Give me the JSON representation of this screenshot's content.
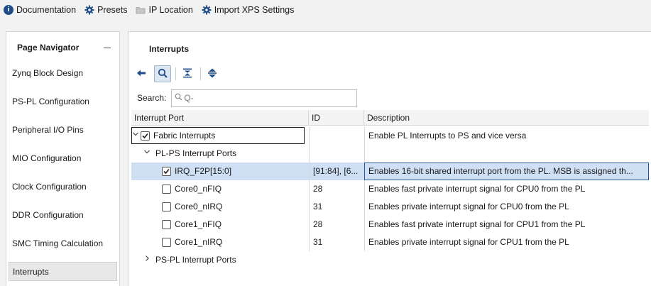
{
  "toolbar": {
    "items": [
      {
        "label": "Documentation",
        "icon": "info-icon"
      },
      {
        "label": "Presets",
        "icon": "gear-icon"
      },
      {
        "label": "IP Location",
        "icon": "folder-icon"
      },
      {
        "label": "Import XPS Settings",
        "icon": "gear-icon"
      }
    ]
  },
  "navigator": {
    "title": "Page Navigator",
    "items": [
      {
        "label": "Zynq Block Design"
      },
      {
        "label": "PS-PL Configuration"
      },
      {
        "label": "Peripheral I/O Pins"
      },
      {
        "label": "MIO Configuration"
      },
      {
        "label": "Clock Configuration"
      },
      {
        "label": "DDR Configuration"
      },
      {
        "label": "SMC Timing Calculation"
      },
      {
        "label": "Interrupts",
        "selected": true
      }
    ]
  },
  "main": {
    "title": "Interrupts",
    "icons": [
      "collapse-all-icon",
      "search-icon",
      "expand-all-icon",
      "sort-icon"
    ],
    "search": {
      "label": "Search:",
      "placeholder": "Q-",
      "value": ""
    },
    "columns": [
      "Interrupt Port",
      "ID",
      "Description"
    ],
    "rows": [
      {
        "port": "Fabric Interrupts",
        "id": "",
        "desc": "Enable PL Interrupts to PS and vice versa",
        "checkbox": true,
        "checked": true,
        "expanded": true,
        "level": 0
      },
      {
        "port": "PL-PS Interrupt Ports",
        "id": "",
        "desc": "",
        "checkbox": false,
        "expanded": true,
        "level": 1
      },
      {
        "port": "IRQ_F2P[15:0]",
        "id": "[91:84], [6...",
        "desc": "Enables 16-bit shared interrupt port from the PL. MSB is assigned th...",
        "checkbox": true,
        "checked": true,
        "level": 2,
        "selected": true
      },
      {
        "port": "Core0_nFIQ",
        "id": "28",
        "desc": "Enables fast private interrupt signal for CPU0 from the PL",
        "checkbox": true,
        "checked": false,
        "level": 2
      },
      {
        "port": "Core0_nIRQ",
        "id": "31",
        "desc": "Enables private interrupt signal for CPU0 from the PL",
        "checkbox": true,
        "checked": false,
        "level": 2
      },
      {
        "port": "Core1_nFIQ",
        "id": "28",
        "desc": "Enables fast private interrupt signal for CPU1 from the PL",
        "checkbox": true,
        "checked": false,
        "level": 2
      },
      {
        "port": "Core1_nIRQ",
        "id": "31",
        "desc": "Enables private interrupt signal for CPU1 from the PL",
        "checkbox": true,
        "checked": false,
        "level": 2
      },
      {
        "port": "PS-PL Interrupt Ports",
        "id": "",
        "desc": "",
        "checkbox": false,
        "expanded": false,
        "level": 1
      }
    ]
  },
  "colors": {
    "accent": "#2b5797",
    "selection": "#cfe0f5",
    "icon_blue": "#1f4d8a"
  }
}
